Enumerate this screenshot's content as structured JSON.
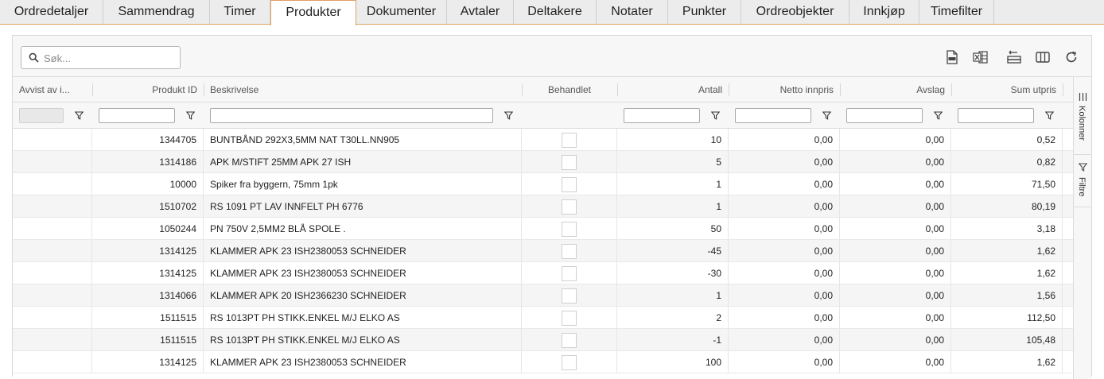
{
  "tabs": [
    {
      "label": "Ordredetaljer",
      "active": false
    },
    {
      "label": "Sammendrag",
      "active": false
    },
    {
      "label": "Timer",
      "active": false
    },
    {
      "label": "Produkter",
      "active": true
    },
    {
      "label": "Dokumenter",
      "active": false
    },
    {
      "label": "Avtaler",
      "active": false
    },
    {
      "label": "Deltakere",
      "active": false
    },
    {
      "label": "Notater",
      "active": false
    },
    {
      "label": "Punkter",
      "active": false
    },
    {
      "label": "Ordreobjekter",
      "active": false
    },
    {
      "label": "Innkjøp",
      "active": false
    },
    {
      "label": "Timefilter",
      "active": false
    }
  ],
  "search": {
    "placeholder": "Søk...",
    "value": ""
  },
  "toolbar_icons": [
    "pdf-export-icon",
    "excel-export-icon",
    "row-height-icon",
    "columns-icon",
    "refresh-icon"
  ],
  "columns": {
    "avvist": "Avvist av i...",
    "produkt_id": "Produkt ID",
    "beskrivelse": "Beskrivelse",
    "behandlet": "Behandlet",
    "antall": "Antall",
    "netto_innpris": "Netto innpris",
    "avslag": "Avslag",
    "sum_utpris": "Sum utpris"
  },
  "rows": [
    {
      "avvist": "",
      "produkt_id": "1344705",
      "beskrivelse": "BUNTBÅND 292X3,5MM NAT T30LL.NN905",
      "behandlet": false,
      "antall": "10",
      "netto_innpris": "0,00",
      "avslag": "0,00",
      "sum_utpris": "0,52"
    },
    {
      "avvist": "",
      "produkt_id": "1314186",
      "beskrivelse": "APK M/STIFT 25MM APK 27 ISH",
      "behandlet": false,
      "antall": "5",
      "netto_innpris": "0,00",
      "avslag": "0,00",
      "sum_utpris": "0,82"
    },
    {
      "avvist": "",
      "produkt_id": "10000",
      "beskrivelse": "Spiker fra byggern, 75mm 1pk",
      "behandlet": false,
      "antall": "1",
      "netto_innpris": "0,00",
      "avslag": "0,00",
      "sum_utpris": "71,50"
    },
    {
      "avvist": "",
      "produkt_id": "1510702",
      "beskrivelse": "RS 1091 PT LAV INNFELT PH 6776",
      "behandlet": false,
      "antall": "1",
      "netto_innpris": "0,00",
      "avslag": "0,00",
      "sum_utpris": "80,19"
    },
    {
      "avvist": "",
      "produkt_id": "1050244",
      "beskrivelse": "PN 750V 2,5MM2 BLÅ SPOLE .",
      "behandlet": false,
      "antall": "50",
      "netto_innpris": "0,00",
      "avslag": "0,00",
      "sum_utpris": "3,18"
    },
    {
      "avvist": "",
      "produkt_id": "1314125",
      "beskrivelse": "KLAMMER APK 23 ISH2380053 SCHNEIDER",
      "behandlet": false,
      "antall": "-45",
      "netto_innpris": "0,00",
      "avslag": "0,00",
      "sum_utpris": "1,62"
    },
    {
      "avvist": "",
      "produkt_id": "1314125",
      "beskrivelse": "KLAMMER APK 23 ISH2380053 SCHNEIDER",
      "behandlet": false,
      "antall": "-30",
      "netto_innpris": "0,00",
      "avslag": "0,00",
      "sum_utpris": "1,62"
    },
    {
      "avvist": "",
      "produkt_id": "1314066",
      "beskrivelse": "KLAMMER APK 20 ISH2366230 SCHNEIDER",
      "behandlet": false,
      "antall": "1",
      "netto_innpris": "0,00",
      "avslag": "0,00",
      "sum_utpris": "1,56"
    },
    {
      "avvist": "",
      "produkt_id": "1511515",
      "beskrivelse": "RS 1013PT PH STIKK.ENKEL M/J ELKO AS",
      "behandlet": false,
      "antall": "2",
      "netto_innpris": "0,00",
      "avslag": "0,00",
      "sum_utpris": "112,50"
    },
    {
      "avvist": "",
      "produkt_id": "1511515",
      "beskrivelse": "RS 1013PT PH STIKK.ENKEL M/J ELKO AS",
      "behandlet": false,
      "antall": "-1",
      "netto_innpris": "0,00",
      "avslag": "0,00",
      "sum_utpris": "105,48"
    },
    {
      "avvist": "",
      "produkt_id": "1314125",
      "beskrivelse": "KLAMMER APK 23 ISH2380053 SCHNEIDER",
      "behandlet": false,
      "antall": "100",
      "netto_innpris": "0,00",
      "avslag": "0,00",
      "sum_utpris": "1,62"
    }
  ],
  "side_panel": {
    "columns_label": "Kolonner",
    "filters_label": "Filtre"
  },
  "colors": {
    "accent": "#e0a060",
    "toolbar_bg": "#f7f7f7",
    "row_alt": "#f5f5f5"
  }
}
